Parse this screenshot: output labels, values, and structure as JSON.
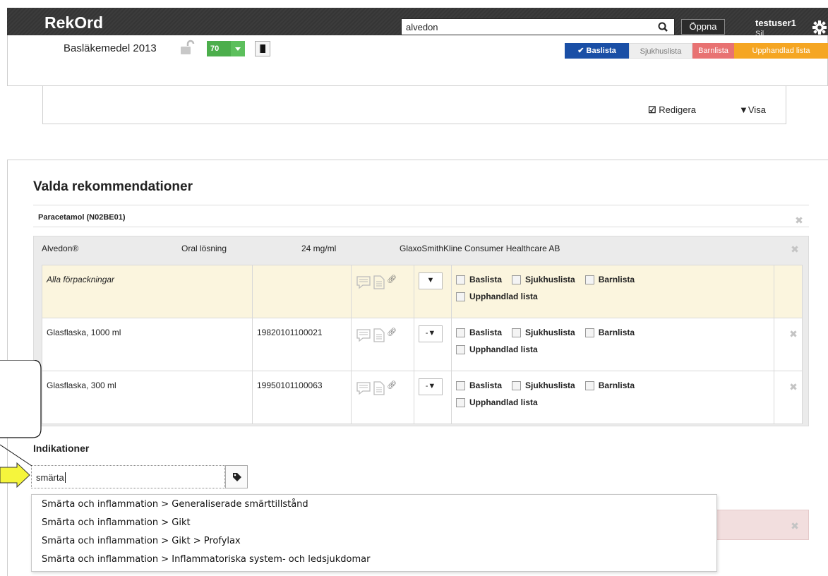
{
  "header": {
    "logo": "RekOrd",
    "search_value": "alvedon",
    "open_label": "Öppna",
    "username": "testuser1",
    "user_sub": "Sil"
  },
  "subbar": {
    "list_title": "Basläkemedel 2013",
    "count": "70",
    "tags": {
      "baslista": "Baslista",
      "sjukhuslista": "Sjukhuslista",
      "barnlista": "Barnlista",
      "upphandlad": "Upphandlad lista"
    },
    "edit": "Redigera",
    "visa": "Visa"
  },
  "main": {
    "title": "Valda rekommendationer",
    "substance": "Paracetamol (N02BE01)",
    "drug": {
      "name": "Alvedon®",
      "form": "Oral lösning",
      "strength": "24 mg/ml",
      "company": "GlaxoSmithKline Consumer Healthcare AB"
    },
    "packages": [
      {
        "name": "Alla förpackningar",
        "nr": "",
        "select": "",
        "italic": true
      },
      {
        "name": "Glasflaska, 1000 ml",
        "nr": "19820101100021",
        "select": "-"
      },
      {
        "name": "Glasflaska, 300 ml",
        "nr": "19950101100063",
        "select": "-"
      }
    ],
    "checkbox_labels": {
      "baslista": "Baslista",
      "sjukhuslista": "Sjukhuslista",
      "barnlista": "Barnlista",
      "upphandlad": "Upphandlad lista"
    },
    "indications_title": "Indikationer",
    "indication_input": "smärta",
    "suggestions": [
      "Smärta och inflammation > Generaliserade smärttillstånd",
      "Smärta och inflammation > Gikt",
      "Smärta och inflammation > Gikt > Profylax",
      "Smärta och inflammation > Inflammatoriska system- och ledsjukdomar"
    ]
  },
  "colors": {
    "header_bg": "#3c3c3c",
    "baslista": "#1a4fa6",
    "barnlista": "#e87272",
    "upphandlad": "#f5a623",
    "count_badge": "#4cae4c",
    "highlight_row": "#fbf5de",
    "callout_arrow": "#f5f53c"
  }
}
